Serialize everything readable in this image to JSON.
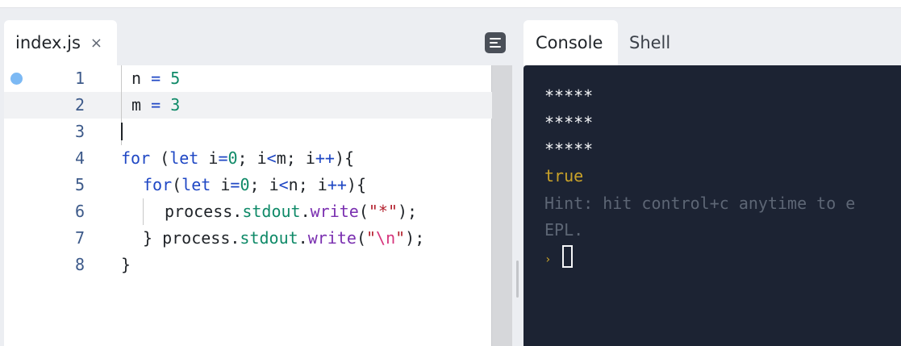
{
  "editor": {
    "tab_label": "index.js",
    "close_glyph": "×",
    "format_button_icon": "format-icon",
    "line_numbers": [
      "1",
      "2",
      "3",
      "4",
      "5",
      "6",
      "7",
      "8"
    ],
    "code": {
      "l1_var": "n",
      "l1_op": "=",
      "l1_num": "5",
      "l2_var": "m",
      "l2_op": "=",
      "l2_num": "3",
      "l4_kw": "for",
      "l4_a": " (",
      "l4_let": "let",
      "l4_b": " i",
      "l4_eq": "=",
      "l4_zero": "0",
      "l4_c": "; i",
      "l4_lt": "<",
      "l4_d": "m; i",
      "l4_inc": "++",
      "l4_e": "){",
      "l5_kw": "for",
      "l5_a": "(",
      "l5_let": "let",
      "l5_b": " i",
      "l5_eq": "=",
      "l5_zero": "0",
      "l5_c": "; i",
      "l5_lt": "<",
      "l5_d": "n; i",
      "l5_inc": "++",
      "l5_e": "){",
      "l6_a": "process.",
      "l6_stdout": "stdout",
      "l6_dot": ".",
      "l6_write": "write",
      "l6_op": "(",
      "l6_str": "\"*\"",
      "l6_end": ");",
      "l7_a": "} process.",
      "l7_stdout": "stdout",
      "l7_dot": ".",
      "l7_write": "write",
      "l7_op": "(",
      "l7_q1": "\"",
      "l7_esc": "\\n",
      "l7_q2": "\"",
      "l7_end": ");",
      "l8": "}"
    }
  },
  "console": {
    "tabs": [
      "Console",
      "Shell"
    ],
    "output": [
      "*****",
      "*****",
      "*****"
    ],
    "result": "true",
    "hint_line1": "Hint: hit control+c anytime to e",
    "hint_line2": "EPL.",
    "prompt_glyph": "›"
  },
  "colors": {
    "keyword": "#1f47c4",
    "number": "#0f8a68",
    "string": "#b3212e",
    "escape": "#d6357c",
    "method": "#7a2fb0",
    "console_bg": "#1c2333",
    "console_result": "#c9a229",
    "breakpoint": "#7cb9f4"
  }
}
